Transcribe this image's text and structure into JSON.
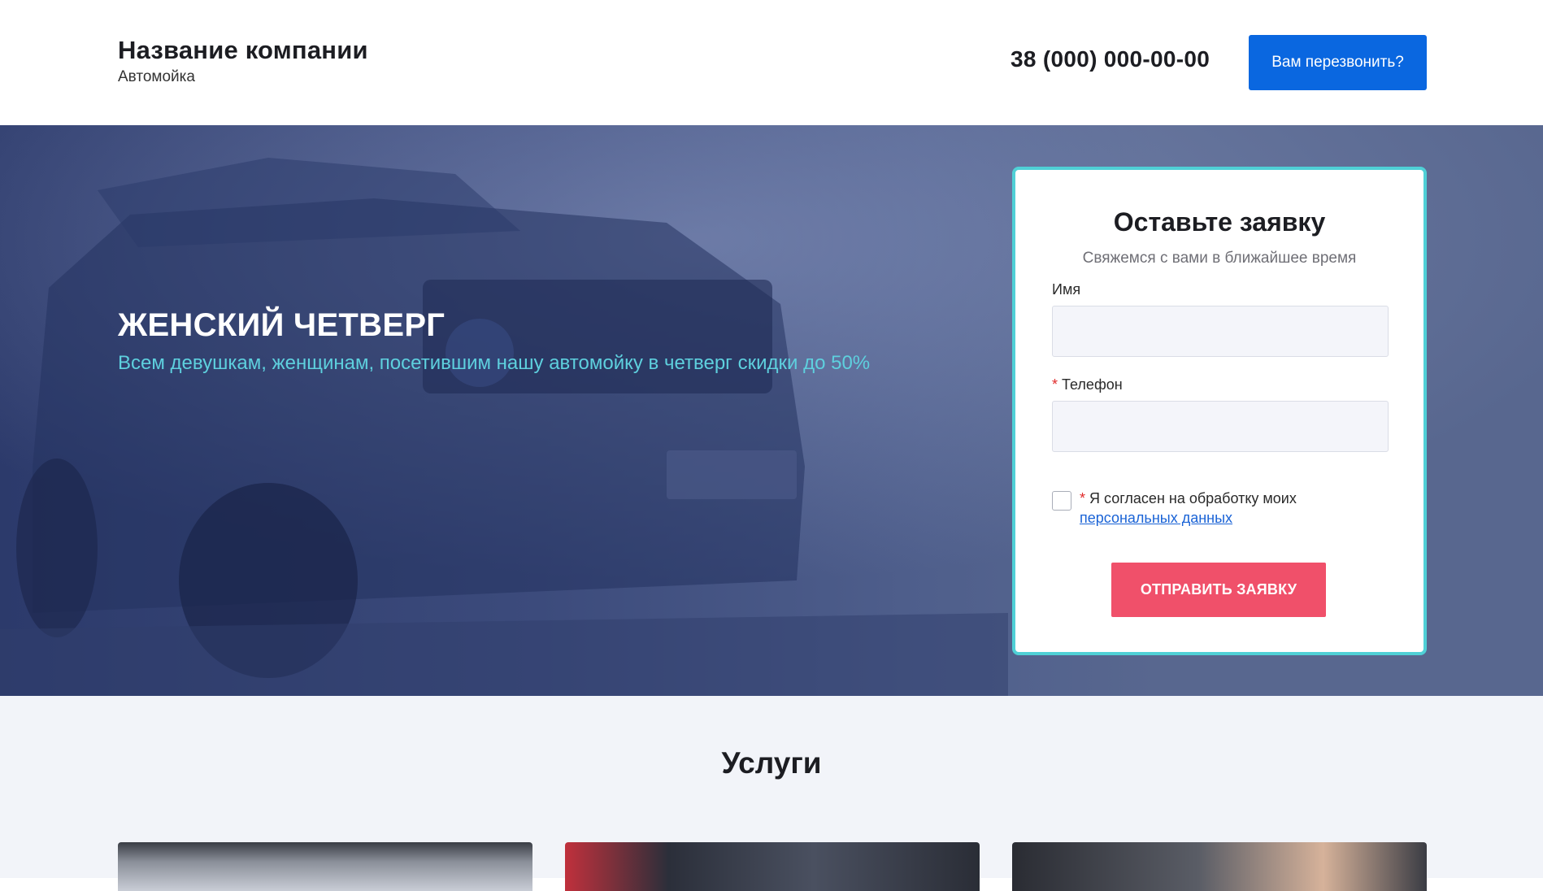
{
  "header": {
    "company_name": "Название компании",
    "company_subtitle": "Автомойка",
    "phone": "38 (000) 000-00-00",
    "callback_label": "Вам перезвонить?"
  },
  "hero": {
    "title": "ЖЕНСКИЙ ЧЕТВЕРГ",
    "subtitle": "Всем девушкам, женщинам, посетившим нашу автомойку в четверг скидки до 50%"
  },
  "form": {
    "title": "Оставьте заявку",
    "subtitle": "Свяжемся с вами в ближайшее время",
    "name_label": "Имя",
    "name_value": "",
    "phone_label": "Телефон",
    "phone_required_mark": "*",
    "phone_value": "",
    "consent_required_mark": "*",
    "consent_text": "Я согласен на обработку моих",
    "consent_link": "персональных данных",
    "consent_checked": false,
    "submit_label": "Отправить заявку"
  },
  "services": {
    "title": "Услуги"
  },
  "colors": {
    "primary_button": "#0a67e0",
    "accent_red": "#f0506a",
    "form_border": "#4fd0d6",
    "hero_overlay": "#3c4b7c",
    "hero_subtitle": "#5ed0de"
  }
}
